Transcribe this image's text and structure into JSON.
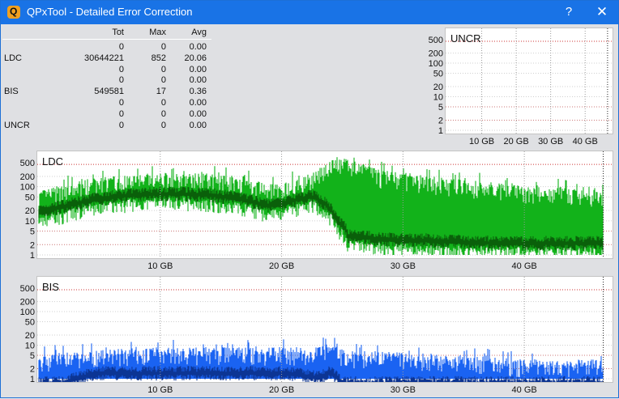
{
  "window": {
    "title": "QPxTool - Detailed Error Correction",
    "help_label": "?",
    "close_label": "✕",
    "icon_letter": "Q"
  },
  "stats": {
    "columns": [
      "Tot",
      "Max",
      "Avg"
    ],
    "rows": [
      {
        "label": "",
        "tot": "0",
        "max": "0",
        "avg": "0.00"
      },
      {
        "label": "LDC",
        "tot": "30644221",
        "max": "852",
        "avg": "20.06"
      },
      {
        "label": "",
        "tot": "0",
        "max": "0",
        "avg": "0.00"
      },
      {
        "label": "",
        "tot": "0",
        "max": "0",
        "avg": "0.00"
      },
      {
        "label": "BIS",
        "tot": "549581",
        "max": "17",
        "avg": "0.36"
      },
      {
        "label": "",
        "tot": "0",
        "max": "0",
        "avg": "0.00"
      },
      {
        "label": "",
        "tot": "0",
        "max": "0",
        "avg": "0.00"
      },
      {
        "label": "UNCR",
        "tot": "0",
        "max": "0",
        "avg": "0.00"
      }
    ]
  },
  "chart_data": [
    {
      "id": "uncr",
      "type": "area",
      "title": "UNCR",
      "yscale": "log",
      "yticks": [
        500,
        200,
        100,
        50,
        20,
        10,
        5,
        2,
        1
      ],
      "xticks": [
        "10 GB",
        "20 GB",
        "30 GB",
        "40 GB"
      ],
      "xtick_values": [
        10,
        20,
        30,
        40
      ],
      "xmax_gb": 47,
      "end_marker_gb": 46.5,
      "series": []
    },
    {
      "id": "ldc",
      "type": "area",
      "title": "LDC",
      "yscale": "log",
      "yticks": [
        500,
        200,
        100,
        50,
        20,
        10,
        5,
        2,
        1
      ],
      "xticks": [
        "10 GB",
        "20 GB",
        "30 GB",
        "40 GB"
      ],
      "xtick_values": [
        10,
        20,
        30,
        40
      ],
      "xmax_gb": 47,
      "end_marker_gb": 46.5,
      "colors": {
        "peak": "#12b21a",
        "avg": "#0b5d0b"
      },
      "profile": {
        "x_gb": [
          0,
          2,
          5,
          8,
          11,
          14,
          17,
          18.5,
          20,
          21,
          22.5,
          23.5,
          24.5,
          25.5,
          28,
          33,
          38,
          43,
          46.5
        ],
        "avg": [
          25,
          35,
          60,
          80,
          85,
          80,
          55,
          40,
          40,
          55,
          70,
          45,
          15,
          5,
          4,
          3.5,
          3,
          3,
          3
        ],
        "peak": [
          60,
          90,
          150,
          190,
          200,
          200,
          150,
          100,
          90,
          140,
          180,
          400,
          600,
          500,
          250,
          150,
          100,
          80,
          60
        ]
      }
    },
    {
      "id": "bis",
      "type": "area",
      "title": "BIS",
      "yscale": "log",
      "yticks": [
        500,
        200,
        100,
        50,
        20,
        10,
        5,
        2,
        1
      ],
      "xticks": [
        "10 GB",
        "20 GB",
        "30 GB",
        "40 GB"
      ],
      "xtick_values": [
        10,
        20,
        30,
        40
      ],
      "xmax_gb": 47,
      "end_marker_gb": 46.5,
      "colors": {
        "peak": "#1b63f2",
        "avg": "#0c3391"
      },
      "profile": {
        "x_gb": [
          0,
          2,
          5,
          10,
          15,
          20,
          23,
          24,
          25,
          30,
          35,
          40,
          46.5
        ],
        "avg": [
          1,
          1,
          2,
          2,
          2,
          2,
          1.5,
          2,
          1,
          1,
          1,
          1,
          1
        ],
        "peak": [
          4,
          5,
          6,
          7,
          7,
          7,
          7,
          9,
          6,
          5,
          4,
          3,
          3
        ]
      }
    }
  ]
}
